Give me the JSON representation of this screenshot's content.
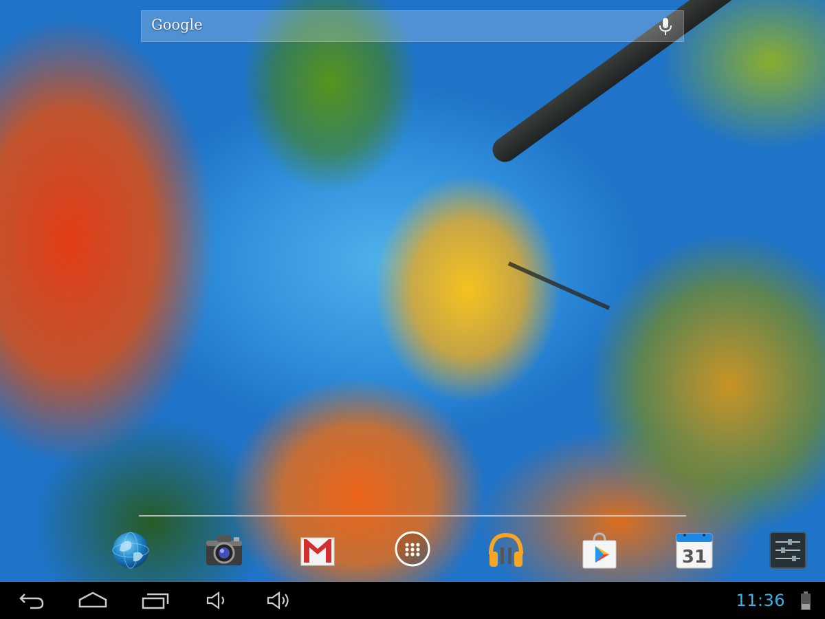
{
  "search": {
    "brand": "Google"
  },
  "dock": {
    "apps": [
      {
        "id": "browser",
        "icon": "globe-icon"
      },
      {
        "id": "camera",
        "icon": "camera-icon"
      },
      {
        "id": "gmail",
        "icon": "gmail-icon"
      },
      {
        "id": "all-apps",
        "icon": "apps-grid-icon"
      },
      {
        "id": "play-music",
        "icon": "headphones-icon"
      },
      {
        "id": "play-store",
        "icon": "play-store-icon"
      },
      {
        "id": "calendar",
        "icon": "calendar-icon",
        "label": "31"
      },
      {
        "id": "settings",
        "icon": "settings-sliders-icon"
      }
    ]
  },
  "navbar": {
    "buttons": [
      "back-icon",
      "home-icon",
      "recent-apps-icon",
      "volume-down-icon",
      "volume-up-icon"
    ],
    "clock": "11:36",
    "battery_icon": "battery-icon"
  },
  "colors": {
    "clock": "#33b5e5",
    "nav_background": "#000000"
  }
}
